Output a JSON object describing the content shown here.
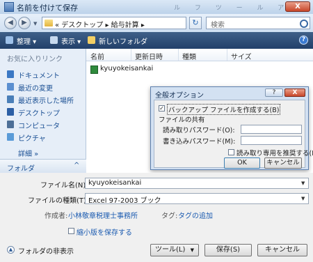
{
  "window": {
    "title": "名前を付けて保存",
    "close": "X",
    "ghost_menu": "ル フ ツ ー ル ア"
  },
  "nav": {
    "back": "◀",
    "forward": "▶",
    "history_arrow": "▼",
    "breadcrumb": "« デスクトップ ▸ 給与計算 ▸",
    "address_arrow": "▼",
    "refresh": "↻",
    "search_placeholder": "検索"
  },
  "toolbar": {
    "organize": "整理 ▾",
    "views": "表示 ▾",
    "new_folder": "新しいフォルダ",
    "help": "?"
  },
  "sidebar": {
    "heading": "お気に入りリンク",
    "items": [
      {
        "label": "ドキュメント",
        "icon": "documents-icon",
        "color": "#3b78c4"
      },
      {
        "label": "最近の変更",
        "icon": "recent-changes-icon",
        "color": "#5b8fd0"
      },
      {
        "label": "最近表示した場所",
        "icon": "recent-places-icon",
        "color": "#4a7fb8"
      },
      {
        "label": "デスクトップ",
        "icon": "desktop-icon",
        "color": "#2c5fa5"
      },
      {
        "label": "コンピュータ",
        "icon": "computer-icon",
        "color": "#4d6f97"
      },
      {
        "label": "ピクチャ",
        "icon": "pictures-icon",
        "color": "#5a9bd8"
      }
    ],
    "more": "詳細 »",
    "folders_label": "フォルダ",
    "folders_chevron": "^"
  },
  "file_list": {
    "columns": [
      "名前",
      "更新日時",
      "種類",
      "サイズ"
    ],
    "files": [
      {
        "name": "kyuyokeisankai",
        "icon": "excel-file-icon"
      }
    ]
  },
  "general_options": {
    "title": "全般オプション",
    "help_btn": "?",
    "close_btn": "X",
    "create_backup_label": "バックアップ ファイルを作成する(B)",
    "create_backup_checked": true,
    "create_backup_mark": "✓",
    "file_sharing_label": "ファイルの共有",
    "read_password_label": "読み取りパスワード(O):",
    "read_password_value": "",
    "write_password_label": "書き込みパスワード(M):",
    "write_password_value": "",
    "read_only_recommended_label": "読み取り専用を推奨する(R)",
    "read_only_recommended_checked": false,
    "ok": "OK",
    "cancel": "キャンセル"
  },
  "form": {
    "filename_label": "ファイル名(N):",
    "filename_value": "kyuyokeisankai",
    "filetype_label": "ファイルの種類(T):",
    "filetype_value": "Excel 97-2003 ブック",
    "author_label": "作成者:",
    "author_value": "小林敬章税理士事務所",
    "tags_label": "タグ:",
    "tags_value": "タグの追加",
    "thumbnail_label": "縮小版を保存する",
    "thumbnail_checked": false,
    "hide_folders": "フォルダの非表示",
    "tools": "ツール(L)",
    "tools_arrow": "▼",
    "save": "保存(S)",
    "cancel": "キャンセル"
  }
}
